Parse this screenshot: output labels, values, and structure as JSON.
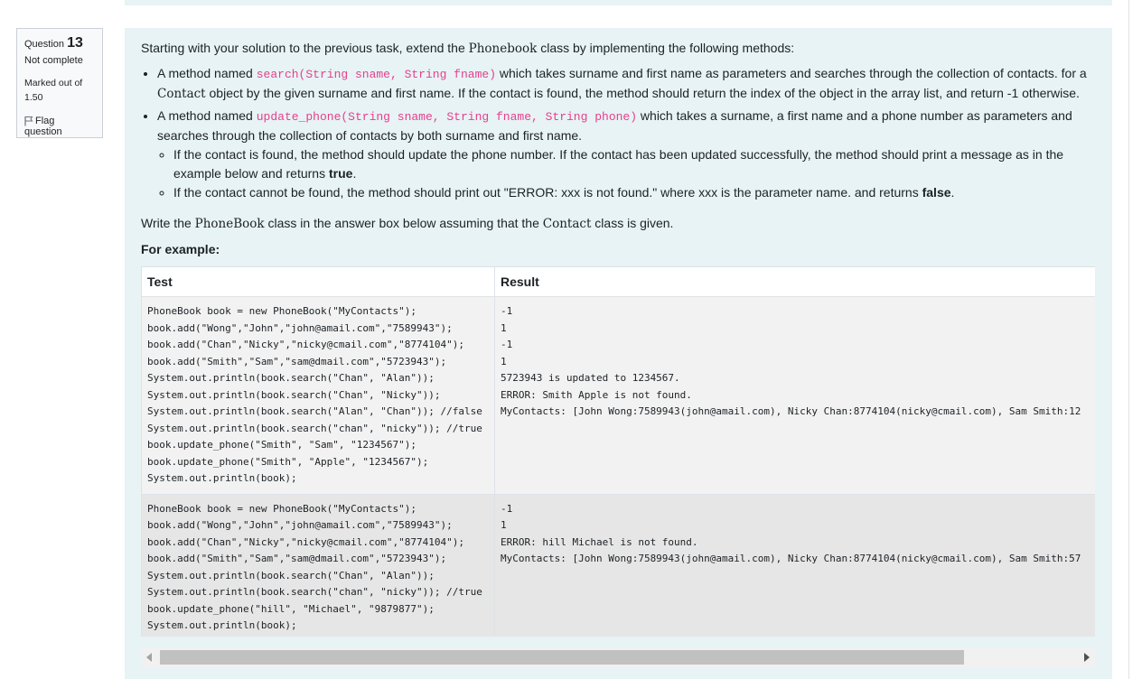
{
  "info": {
    "question_word": "Question",
    "question_number": "13",
    "state": "Not complete",
    "grade": "Marked out of 1.50",
    "flag": "Flag question"
  },
  "qtext": {
    "intro_pre": "Starting with your solution to the previous task, extend the ",
    "intro_class": "Phonebook",
    "intro_post": " class by implementing the following methods:",
    "b1_pre": "A method named ",
    "b1_code": "search(String sname, String fname)",
    "b1_post1": " which takes surname and first name as parameters and searches through the collection of contacts. for a ",
    "b1_class": "Contact",
    "b1_post2": " object by the given surname and first name. If the contact is found, the method should return the index of the object in the array list, and return -1 otherwise.",
    "b2_pre": "A method named ",
    "b2_code": "update_phone(String sname, String fname, String phone)",
    "b2_post": " which takes a surname, a first name and a phone number as parameters and searches through the collection of contacts by both surname and first name.",
    "s1_pre": "If the contact is found, the method should update the phone number. If the contact has been updated successfully, the method should print a message as in the example below and returns ",
    "s1_bold": "true",
    "s1_post": ".",
    "s2_pre": "If the contact cannot be found, the method should print out \"ERROR: xxx is not found.\" where xxx is the parameter name. and returns ",
    "s2_bold": "false",
    "s2_post": ".",
    "write_pre": "Write the ",
    "write_class": "PhoneBook",
    "write_mid": " class in the answer box below assuming that the ",
    "write_class2": "Contact",
    "write_post": " class is given.",
    "for_example": "For example:"
  },
  "table": {
    "headers": [
      "Test",
      "Result"
    ],
    "rows": [
      {
        "test": "PhoneBook book = new PhoneBook(\"MyContacts\");\nbook.add(\"Wong\",\"John\",\"john@amail.com\",\"7589943\");\nbook.add(\"Chan\",\"Nicky\",\"nicky@cmail.com\",\"8774104\");\nbook.add(\"Smith\",\"Sam\",\"sam@dmail.com\",\"5723943\");\nSystem.out.println(book.search(\"Chan\", \"Alan\"));\nSystem.out.println(book.search(\"Chan\", \"Nicky\"));\nSystem.out.println(book.search(\"Alan\", \"Chan\")); //false\nSystem.out.println(book.search(\"chan\", \"nicky\")); //true\nbook.update_phone(\"Smith\", \"Sam\", \"1234567\");\nbook.update_phone(\"Smith\", \"Apple\", \"1234567\");\nSystem.out.println(book);",
        "result": "-1\n1\n-1\n1\n5723943 is updated to 1234567.\nERROR: Smith Apple is not found.\nMyContacts: [John Wong:7589943(john@amail.com), Nicky Chan:8774104(nicky@cmail.com), Sam Smith:12"
      },
      {
        "test": "PhoneBook book = new PhoneBook(\"MyContacts\");\nbook.add(\"Wong\",\"John\",\"john@amail.com\",\"7589943\");\nbook.add(\"Chan\",\"Nicky\",\"nicky@cmail.com\",\"8774104\");\nbook.add(\"Smith\",\"Sam\",\"sam@dmail.com\",\"5723943\");\nSystem.out.println(book.search(\"Chan\", \"Alan\"));\nSystem.out.println(book.search(\"chan\", \"nicky\")); //true\nbook.update_phone(\"hill\", \"Michael\", \"9879877\");\nSystem.out.println(book);",
        "result": "-1\n1\nERROR: hill Michael is not found.\nMyContacts: [John Wong:7589943(john@amail.com), Nicky Chan:8774104(nicky@cmail.com), Sam Smith:57"
      }
    ]
  }
}
